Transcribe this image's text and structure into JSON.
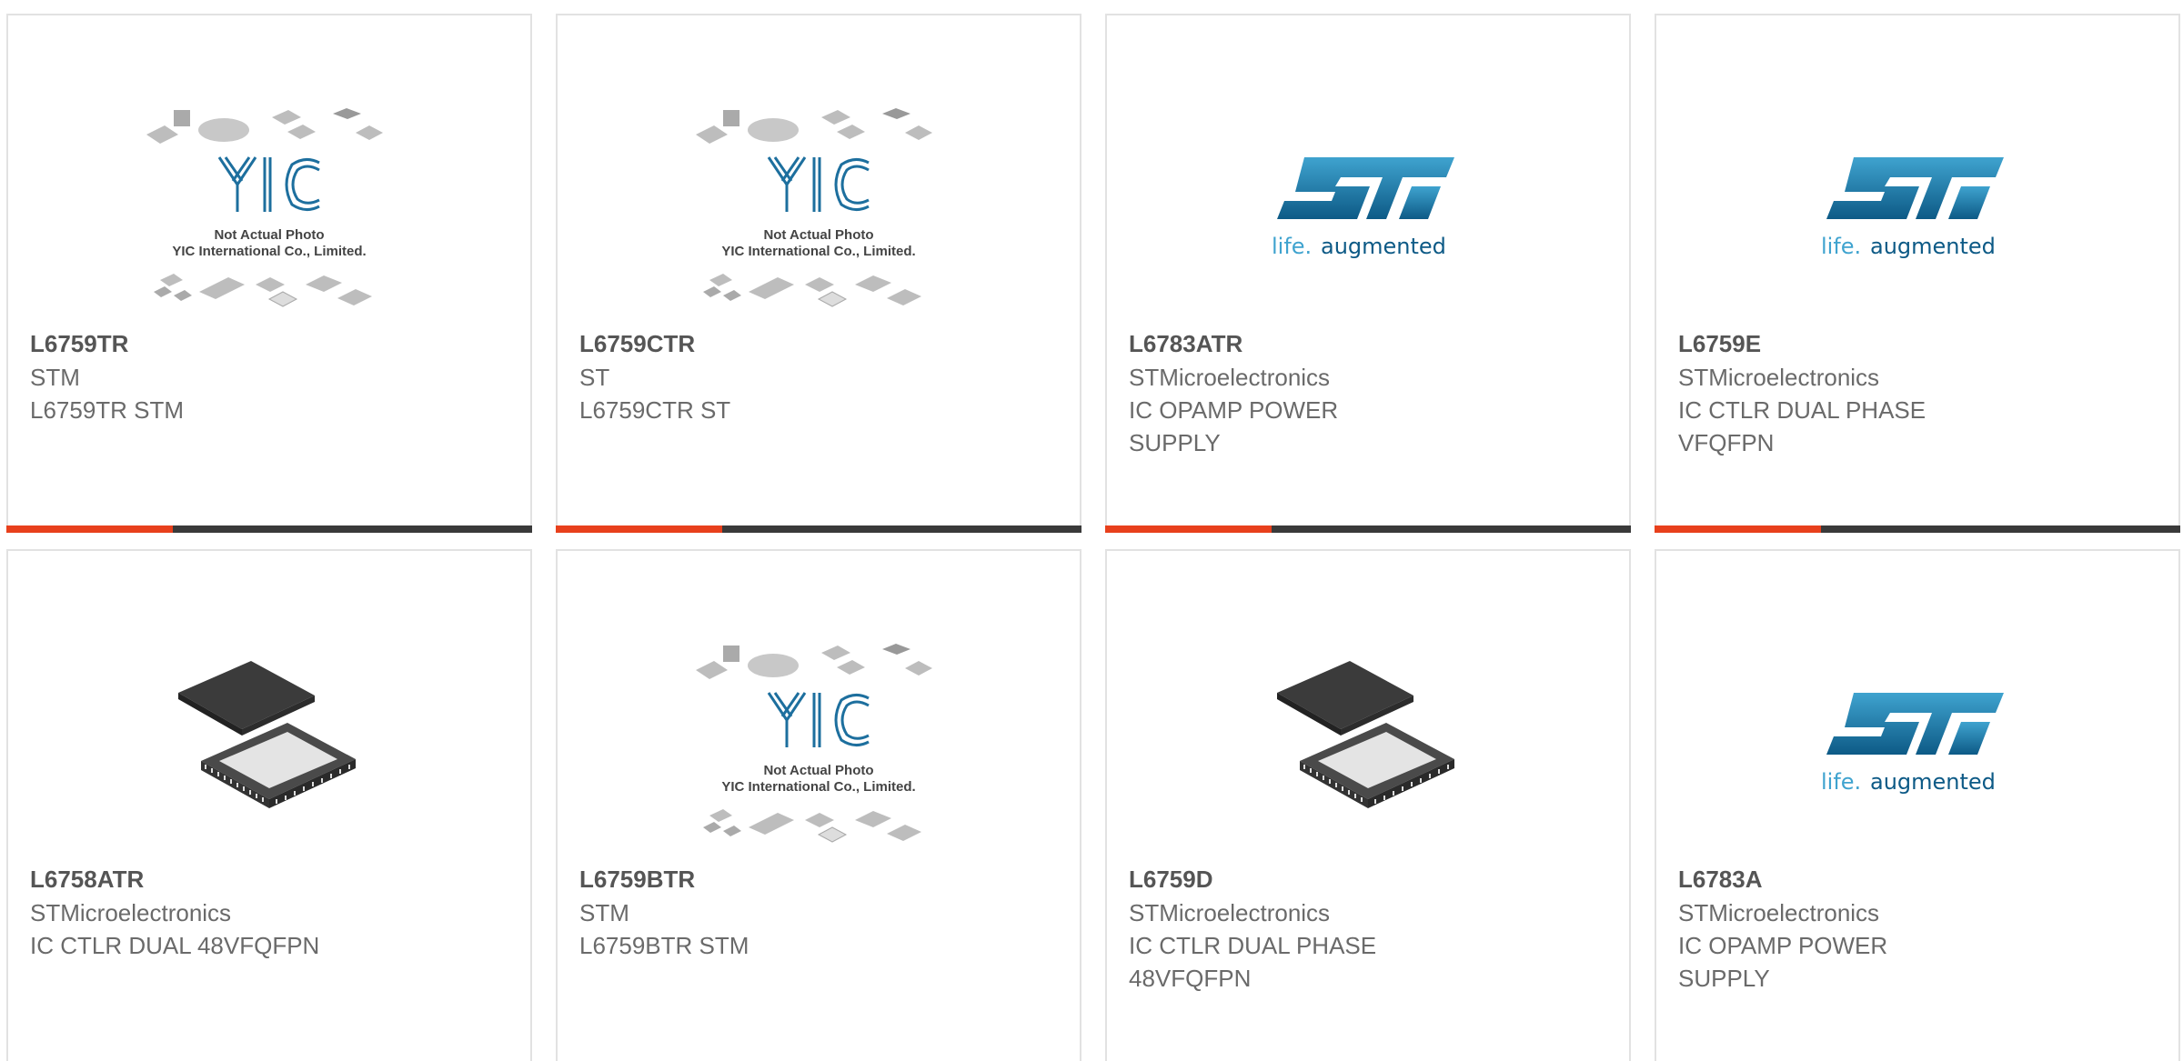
{
  "colors": {
    "accent": "#e8401c",
    "bar_dark": "#3a3a3a",
    "st_blue": "#1d6f9e",
    "border": "#e2e2e2"
  },
  "placeholder": {
    "logo": "YIC",
    "line1": "Not Actual Photo",
    "line2": "YIC International Co., Limited."
  },
  "st_logo": {
    "mark": "ST",
    "tagline_a": "life.",
    "tagline_b": "augmented"
  },
  "products": [
    {
      "part": "L6759TR",
      "manufacturer": "STM",
      "description": "L6759TR STM",
      "image": "placeholder-photo"
    },
    {
      "part": "L6759CTR",
      "manufacturer": "ST",
      "description": "L6759CTR ST",
      "image": "placeholder-photo"
    },
    {
      "part": "L6783ATR",
      "manufacturer": "STMicroelectronics",
      "description": "IC OPAMP POWER SUPPLY",
      "image": "st-logo"
    },
    {
      "part": "L6759E",
      "manufacturer": "STMicroelectronics",
      "description": "IC CTLR DUAL PHASE VFQFPN",
      "image": "st-logo"
    },
    {
      "part": "L6758ATR",
      "manufacturer": "STMicroelectronics",
      "description": "IC CTLR DUAL 48VFQFPN",
      "image": "qfn-chip"
    },
    {
      "part": "L6759BTR",
      "manufacturer": "STM",
      "description": "L6759BTR STM",
      "image": "placeholder-photo"
    },
    {
      "part": "L6759D",
      "manufacturer": "STMicroelectronics",
      "description": "IC CTLR DUAL PHASE 48VFQFPN",
      "image": "qfn-chip"
    },
    {
      "part": "L6783A",
      "manufacturer": "STMicroelectronics",
      "description": "IC OPAMP POWER SUPPLY",
      "image": "st-logo"
    }
  ]
}
